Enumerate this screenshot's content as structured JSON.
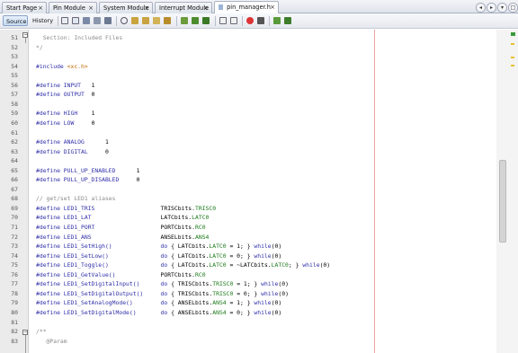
{
  "tabs": [
    {
      "label": "Start Page"
    },
    {
      "label": "Pin Module"
    },
    {
      "label": "System Module"
    },
    {
      "label": "Interrupt Module"
    },
    {
      "label": "pin_manager.h"
    }
  ],
  "toolbar": {
    "source_label": "Source",
    "history_label": "History"
  },
  "code_lines": [
    {
      "n": "51",
      "parts": [
        {
          "t": "  Section: Included Files",
          "c": "c"
        }
      ]
    },
    {
      "n": "52",
      "parts": [
        {
          "t": "*/",
          "c": "c"
        }
      ]
    },
    {
      "n": "53",
      "parts": []
    },
    {
      "n": "54",
      "parts": [
        {
          "t": "#include ",
          "c": "k"
        },
        {
          "t": "<xc.h>",
          "c": "s"
        }
      ]
    },
    {
      "n": "55",
      "parts": []
    },
    {
      "n": "56",
      "parts": [
        {
          "t": "#define ",
          "c": "k"
        },
        {
          "t": "INPUT   ",
          "c": "k"
        },
        {
          "t": "1",
          "c": "t"
        }
      ]
    },
    {
      "n": "57",
      "parts": [
        {
          "t": "#define ",
          "c": "k"
        },
        {
          "t": "OUTPUT  ",
          "c": "k"
        },
        {
          "t": "0",
          "c": "t"
        }
      ]
    },
    {
      "n": "58",
      "parts": []
    },
    {
      "n": "59",
      "parts": [
        {
          "t": "#define ",
          "c": "k"
        },
        {
          "t": "HIGH    ",
          "c": "k"
        },
        {
          "t": "1",
          "c": "t"
        }
      ]
    },
    {
      "n": "60",
      "parts": [
        {
          "t": "#define ",
          "c": "k"
        },
        {
          "t": "LOW     ",
          "c": "k"
        },
        {
          "t": "0",
          "c": "t"
        }
      ]
    },
    {
      "n": "61",
      "parts": []
    },
    {
      "n": "62",
      "parts": [
        {
          "t": "#define ",
          "c": "k"
        },
        {
          "t": "ANALOG      ",
          "c": "k"
        },
        {
          "t": "1",
          "c": "t"
        }
      ]
    },
    {
      "n": "63",
      "parts": [
        {
          "t": "#define ",
          "c": "k"
        },
        {
          "t": "DIGITAL     ",
          "c": "k"
        },
        {
          "t": "0",
          "c": "t"
        }
      ]
    },
    {
      "n": "64",
      "parts": []
    },
    {
      "n": "65",
      "parts": [
        {
          "t": "#define ",
          "c": "k"
        },
        {
          "t": "PULL_UP_ENABLED      ",
          "c": "k"
        },
        {
          "t": "1",
          "c": "t"
        }
      ]
    },
    {
      "n": "66",
      "parts": [
        {
          "t": "#define ",
          "c": "k"
        },
        {
          "t": "PULL_UP_DISABLED     ",
          "c": "k"
        },
        {
          "t": "0",
          "c": "t"
        }
      ]
    },
    {
      "n": "67",
      "parts": []
    },
    {
      "n": "68",
      "parts": [
        {
          "t": "// get/set LED1 aliases",
          "c": "c"
        }
      ]
    },
    {
      "n": "69",
      "parts": [
        {
          "t": "#define ",
          "c": "k"
        },
        {
          "t": "LED1_TRIS                   ",
          "c": "k"
        },
        {
          "t": "TRISCbits.",
          "c": "t"
        },
        {
          "t": "TRISC0",
          "c": "m"
        }
      ]
    },
    {
      "n": "70",
      "parts": [
        {
          "t": "#define ",
          "c": "k"
        },
        {
          "t": "LED1_LAT                    ",
          "c": "k"
        },
        {
          "t": "LATCbits.",
          "c": "t"
        },
        {
          "t": "LATC0",
          "c": "m"
        }
      ]
    },
    {
      "n": "71",
      "parts": [
        {
          "t": "#define ",
          "c": "k"
        },
        {
          "t": "LED1_PORT                   ",
          "c": "k"
        },
        {
          "t": "PORTCbits.",
          "c": "t"
        },
        {
          "t": "RC0",
          "c": "m"
        }
      ]
    },
    {
      "n": "72",
      "parts": [
        {
          "t": "#define ",
          "c": "k"
        },
        {
          "t": "LED1_ANS                    ",
          "c": "k"
        },
        {
          "t": "ANSELbits.",
          "c": "t"
        },
        {
          "t": "ANS4",
          "c": "m"
        }
      ]
    },
    {
      "n": "73",
      "parts": [
        {
          "t": "#define ",
          "c": "k"
        },
        {
          "t": "LED1_SetHigh()              ",
          "c": "k"
        },
        {
          "t": "do",
          "c": "k"
        },
        {
          "t": " { LATCbits.",
          "c": "t"
        },
        {
          "t": "LATC0",
          "c": "m"
        },
        {
          "t": " = 1; } ",
          "c": "t"
        },
        {
          "t": "while",
          "c": "k"
        },
        {
          "t": "(0)",
          "c": "t"
        }
      ]
    },
    {
      "n": "74",
      "parts": [
        {
          "t": "#define ",
          "c": "k"
        },
        {
          "t": "LED1_SetLow()               ",
          "c": "k"
        },
        {
          "t": "do",
          "c": "k"
        },
        {
          "t": " { LATCbits.",
          "c": "t"
        },
        {
          "t": "LATC0",
          "c": "m"
        },
        {
          "t": " = 0; } ",
          "c": "t"
        },
        {
          "t": "while",
          "c": "k"
        },
        {
          "t": "(0)",
          "c": "t"
        }
      ]
    },
    {
      "n": "75",
      "parts": [
        {
          "t": "#define ",
          "c": "k"
        },
        {
          "t": "LED1_Toggle()               ",
          "c": "k"
        },
        {
          "t": "do",
          "c": "k"
        },
        {
          "t": " { LATCbits.",
          "c": "t"
        },
        {
          "t": "LATC0",
          "c": "m"
        },
        {
          "t": " = ~LATCbits.",
          "c": "t"
        },
        {
          "t": "LATC0",
          "c": "m"
        },
        {
          "t": "; } ",
          "c": "t"
        },
        {
          "t": "while",
          "c": "k"
        },
        {
          "t": "(0)",
          "c": "t"
        }
      ]
    },
    {
      "n": "76",
      "parts": [
        {
          "t": "#define ",
          "c": "k"
        },
        {
          "t": "LED1_GetValue()             ",
          "c": "k"
        },
        {
          "t": "PORTCbits.",
          "c": "t"
        },
        {
          "t": "RC0",
          "c": "m"
        }
      ]
    },
    {
      "n": "77",
      "parts": [
        {
          "t": "#define ",
          "c": "k"
        },
        {
          "t": "LED1_SetDigitalInput()      ",
          "c": "k"
        },
        {
          "t": "do",
          "c": "k"
        },
        {
          "t": " { TRISCbits.",
          "c": "t"
        },
        {
          "t": "TRISC0",
          "c": "m"
        },
        {
          "t": " = 1; } ",
          "c": "t"
        },
        {
          "t": "while",
          "c": "k"
        },
        {
          "t": "(0)",
          "c": "t"
        }
      ]
    },
    {
      "n": "78",
      "parts": [
        {
          "t": "#define ",
          "c": "k"
        },
        {
          "t": "LED1_SetDigitalOutput()     ",
          "c": "k"
        },
        {
          "t": "do",
          "c": "k"
        },
        {
          "t": " { TRISCbits.",
          "c": "t"
        },
        {
          "t": "TRISC0",
          "c": "m"
        },
        {
          "t": " = 0; } ",
          "c": "t"
        },
        {
          "t": "while",
          "c": "k"
        },
        {
          "t": "(0)",
          "c": "t"
        }
      ]
    },
    {
      "n": "79",
      "parts": [
        {
          "t": "#define ",
          "c": "k"
        },
        {
          "t": "LED1_SetAnalogMode()        ",
          "c": "k"
        },
        {
          "t": "do",
          "c": "k"
        },
        {
          "t": " { ANSELbits.",
          "c": "t"
        },
        {
          "t": "ANS4",
          "c": "m"
        },
        {
          "t": " = 1; } ",
          "c": "t"
        },
        {
          "t": "while",
          "c": "k"
        },
        {
          "t": "(0)",
          "c": "t"
        }
      ]
    },
    {
      "n": "80",
      "parts": [
        {
          "t": "#define ",
          "c": "k"
        },
        {
          "t": "LED1_SetDigitalMode()       ",
          "c": "k"
        },
        {
          "t": "do",
          "c": "k"
        },
        {
          "t": " { ANSELbits.",
          "c": "t"
        },
        {
          "t": "ANS4",
          "c": "m"
        },
        {
          "t": " = 0; } ",
          "c": "t"
        },
        {
          "t": "while",
          "c": "k"
        },
        {
          "t": "(0)",
          "c": "t"
        }
      ]
    },
    {
      "n": "81",
      "parts": []
    },
    {
      "n": "82",
      "parts": [
        {
          "t": "/**",
          "c": "c"
        }
      ]
    },
    {
      "n": "83",
      "parts": [
        {
          "t": "   @Param",
          "c": "c"
        }
      ]
    }
  ]
}
